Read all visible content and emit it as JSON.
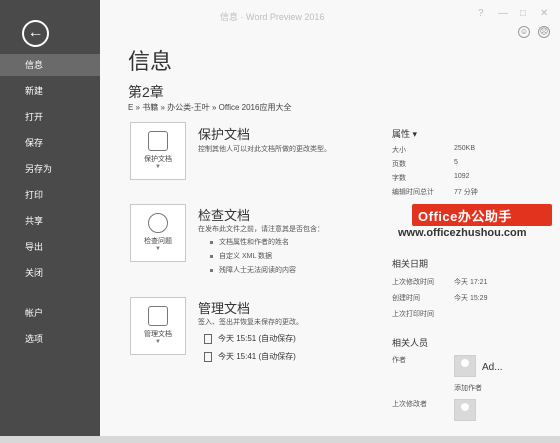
{
  "window": {
    "title": "信息 · Word Preview 2016",
    "help": "?",
    "minimize": "—",
    "restore": "□",
    "close": "✕"
  },
  "sidebar": {
    "items": [
      {
        "label": "信息",
        "active": true
      },
      {
        "label": "新建"
      },
      {
        "label": "打开"
      },
      {
        "label": "保存"
      },
      {
        "label": "另存为"
      },
      {
        "label": "打印"
      },
      {
        "label": "共享"
      },
      {
        "label": "导出"
      },
      {
        "label": "关闭"
      },
      {
        "label": "帐户"
      },
      {
        "label": "选项"
      }
    ]
  },
  "main": {
    "page_title": "信息",
    "doc_title": "第2章",
    "doc_path": "E » 书籍 » 办公类-王叶 » Office 2016应用大全",
    "protect": {
      "card_label": "保护文档",
      "heading": "保护文档",
      "desc": "控制其他人可以对此文档所做的更改类型。"
    },
    "inspect": {
      "card_label": "检查问题",
      "heading": "检查文档",
      "desc": "在发布此文件之前，请注意其是否包含：",
      "bullets": [
        "文档属性和作者的姓名",
        "自定义 XML 数据",
        "残障人士无法阅读的内容"
      ]
    },
    "manage": {
      "card_label": "管理文档",
      "heading": "管理文档",
      "desc": "签入、签出并恢复未保存的更改。",
      "versions": [
        "今天 15:51 (自动保存)",
        "今天 15:41 (自动保存)"
      ]
    }
  },
  "properties": {
    "heading": "属性 ▾",
    "rows": [
      {
        "label": "大小",
        "value": "250KB"
      },
      {
        "label": "页数",
        "value": "5"
      },
      {
        "label": "字数",
        "value": "1092"
      },
      {
        "label": "编辑时间总计",
        "value": "77 分钟"
      }
    ],
    "dates_heading": "相关日期",
    "dates": [
      {
        "label": "上次修改时间",
        "value": "今天 17:21"
      },
      {
        "label": "创建时间",
        "value": "今天 15:29"
      },
      {
        "label": "上次打印时间",
        "value": ""
      }
    ],
    "people_heading": "相关人员",
    "author_label": "作者",
    "author_name": "Ad...",
    "add_author": "添加作者",
    "last_modified_by": "上次修改者"
  },
  "watermark": {
    "badge": "Office办公助手",
    "url": "www.officezhushou.com"
  }
}
